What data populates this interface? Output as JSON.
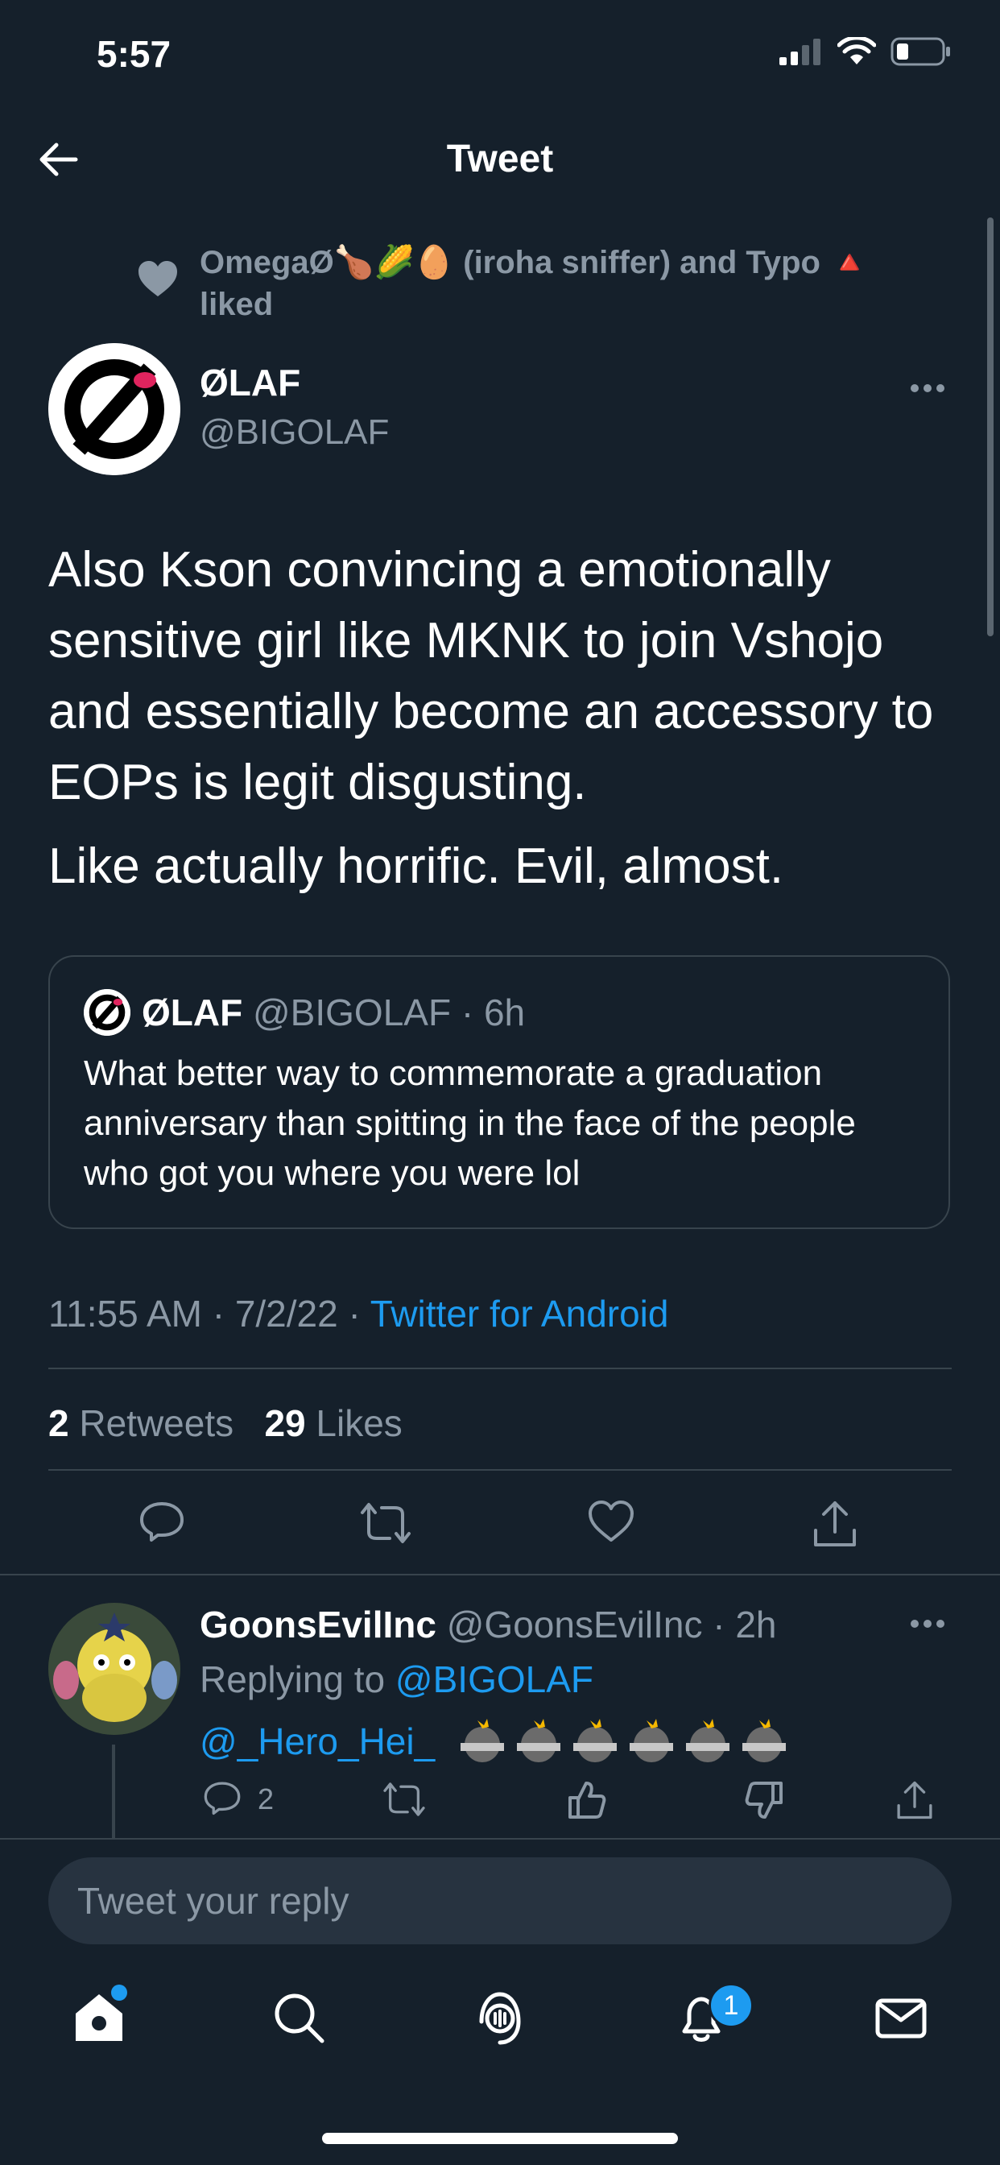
{
  "status_bar": {
    "time": "5:57"
  },
  "header": {
    "title": "Tweet"
  },
  "liked_by": {
    "text": "OmegaØ🍗🌽🥚 (iroha sniffer) and Typo 🔺 liked"
  },
  "tweet": {
    "author_name": "ØLAF",
    "author_handle": "@BIGOLAF",
    "text_p1": "Also Kson convincing a emotionally sensitive girl like MKNK to join Vshojo and essentially become an accessory to EOPs is legit disgusting.",
    "text_p2": "Like actually horrific. Evil, almost.",
    "quote": {
      "author_name": "ØLAF",
      "author_handle": "@BIGOLAF",
      "time": "· 6h",
      "text": "What better way to commemorate a graduation anniversary than spitting in the face of the people who got you where you were lol"
    },
    "timestamp": "11:55 AM · 7/2/22 · ",
    "source": "Twitter for Android",
    "retweets_count": "2",
    "retweets_label": "Retweets",
    "likes_count": "29",
    "likes_label": "Likes"
  },
  "reply": {
    "author_name": "GoonsEvilInc",
    "author_handle": "@GoonsEvilInc",
    "time": "· 2h",
    "replying_prefix": "Replying to ",
    "replying_handle": "@BIGOLAF",
    "mention": "@_Hero_Hei_",
    "reply_count": "2"
  },
  "compose": {
    "placeholder": "Tweet your reply"
  },
  "tab_bar": {
    "notifications_badge": "1"
  },
  "colors": {
    "background": "#15202b",
    "accent": "#1d9bf0",
    "muted": "#8b98a5",
    "border": "#38444d"
  },
  "icons": [
    "back-arrow-icon",
    "heart-icon",
    "more-icon",
    "reply-icon",
    "retweet-icon",
    "like-icon",
    "share-icon",
    "thumbs-up-icon",
    "thumbs-down-icon",
    "home-icon",
    "search-icon",
    "spaces-icon",
    "bell-icon",
    "mail-icon"
  ]
}
